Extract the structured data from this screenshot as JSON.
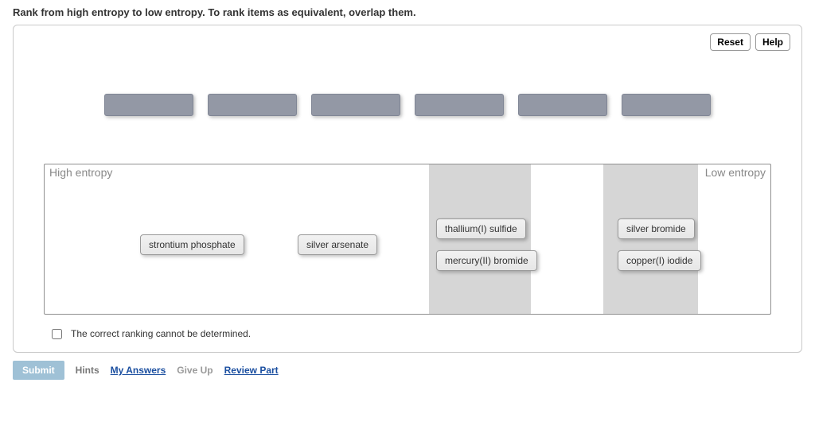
{
  "instruction": "Rank from high entropy to low entropy. To rank items as equivalent, overlap them.",
  "buttons": {
    "reset": "Reset",
    "help": "Help"
  },
  "rank": {
    "high_label": "High entropy",
    "low_label": "Low entropy",
    "chips": {
      "strontium_phosphate": "strontium phosphate",
      "silver_arsenate": "silver arsenate",
      "thallium_sulfide": "thallium(I) sulfide",
      "mercury_bromide": "mercury(II) bromide",
      "silver_bromide": "silver bromide",
      "copper_iodide": "copper(I) iodide"
    }
  },
  "cannot_determine_label": "The correct ranking cannot be determined.",
  "footer": {
    "submit": "Submit",
    "hints": "Hints",
    "my_answers": "My Answers",
    "give_up": "Give Up",
    "review_part": "Review Part"
  }
}
